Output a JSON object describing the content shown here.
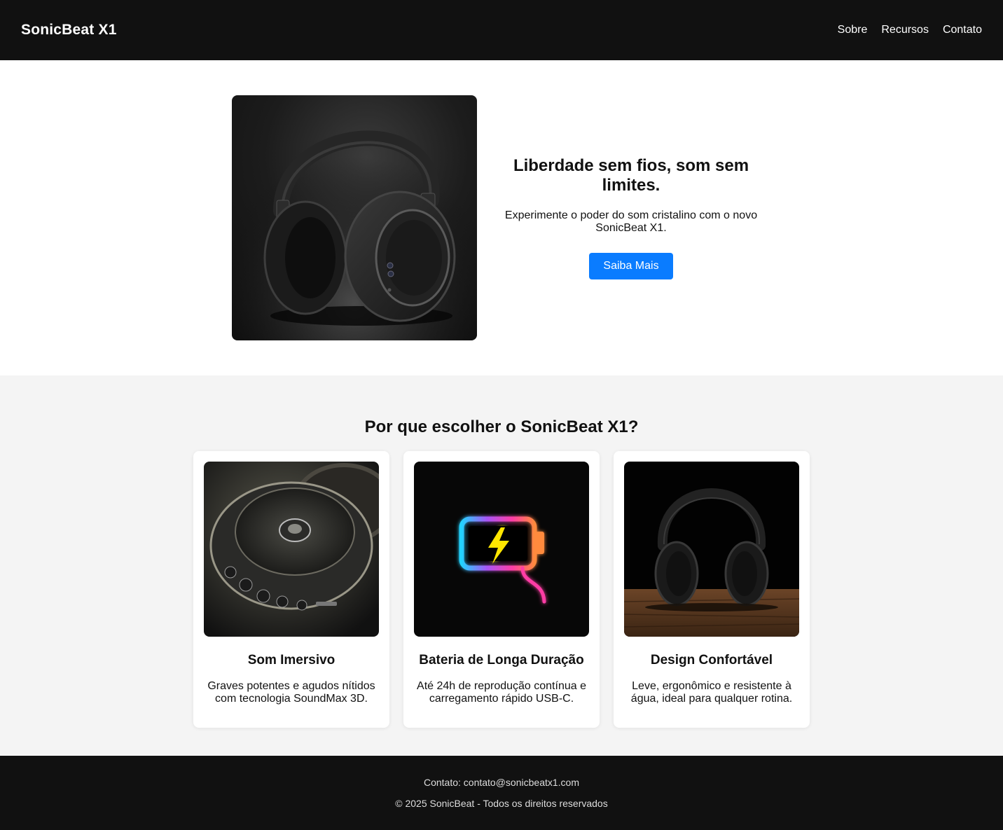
{
  "header": {
    "brand": "SonicBeat X1",
    "nav": [
      {
        "label": "Sobre",
        "icon": "none"
      },
      {
        "label": "Recursos",
        "icon": "none"
      },
      {
        "label": "Contato",
        "icon": "none"
      }
    ]
  },
  "hero": {
    "title": "Liberdade sem fios, som sem limites.",
    "subtitle": "Experimente o poder do som cristalino com o novo SonicBeat X1.",
    "cta_label": "Saiba Mais",
    "accent_color": "#0a7cff"
  },
  "features": {
    "title": "Por que escolher o SonicBeat X1?",
    "cards": [
      {
        "title": "Som Imersivo",
        "desc": "Graves potentes e agudos nítidos com tecnologia SoundMax 3D.",
        "image": "speaker-closeup-image"
      },
      {
        "title": "Bateria de Longa Duração",
        "desc": "Até 24h de reprodução contínua e carregamento rápido USB-C.",
        "image": "neon-battery-image"
      },
      {
        "title": "Design Confortável",
        "desc": "Leve, ergonômico e resistente à água, ideal para qualquer rotina.",
        "image": "headphones-on-table-image"
      }
    ]
  },
  "footer": {
    "contact": "Contato: contato@sonicbeatx1.com",
    "copyright": "© 2025 SonicBeat - Todos os direitos reservados"
  }
}
